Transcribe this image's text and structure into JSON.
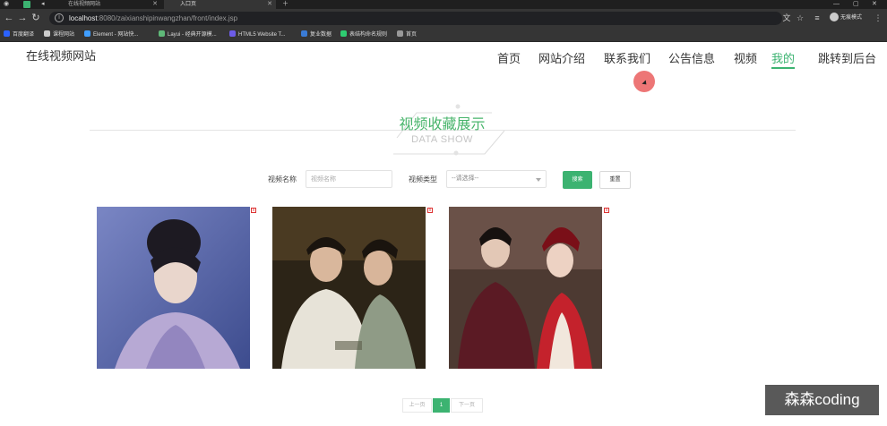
{
  "browser": {
    "tabs": [
      {
        "label": "在线视频网站"
      },
      {
        "label": "入口页"
      }
    ],
    "url_host": "localhost",
    "url_path": ":8080/zaixianshipinwangzhan/front/index.jsp",
    "profile_label": "无痕模式",
    "bookmarks": [
      {
        "label": "百度翻译",
        "color": "#2b62ff"
      },
      {
        "label": "课程网站",
        "color": "#cccccc"
      },
      {
        "label": "Element - 网站快...",
        "color": "#409eff"
      },
      {
        "label": "Layui - 经典开源模...",
        "color": "#5fb878"
      },
      {
        "label": "HTML5 Website T...",
        "color": "#6c5ce7"
      },
      {
        "label": "复业数据",
        "color": "#3a7bd5"
      },
      {
        "label": "表结构命名规则",
        "color": "#2ecc71"
      },
      {
        "label": "首页",
        "color": "#999999"
      }
    ]
  },
  "site": {
    "logo": "在线视频网站",
    "nav": [
      {
        "label": "首页"
      },
      {
        "label": "网站介绍"
      },
      {
        "label": "联系我们"
      },
      {
        "label": "公告信息"
      },
      {
        "label": "视频"
      },
      {
        "label": "我的",
        "active": true
      },
      {
        "label": "跳转到后台"
      }
    ],
    "accent_color": "#3cb371"
  },
  "section": {
    "title": "视频收藏展示",
    "subtitle": "DATA SHOW"
  },
  "search": {
    "name_label": "视频名称",
    "name_placeholder": "视频名称",
    "type_label": "视频类型",
    "type_value": "--请选择--",
    "search_button": "搜索",
    "reset_button": "重置"
  },
  "videos": [
    {
      "name": "video-card-1"
    },
    {
      "name": "video-card-2"
    },
    {
      "name": "video-card-3"
    }
  ],
  "pagination": {
    "prev": "上一页",
    "current": "1",
    "next": "下一页"
  },
  "watermark": "森森coding"
}
